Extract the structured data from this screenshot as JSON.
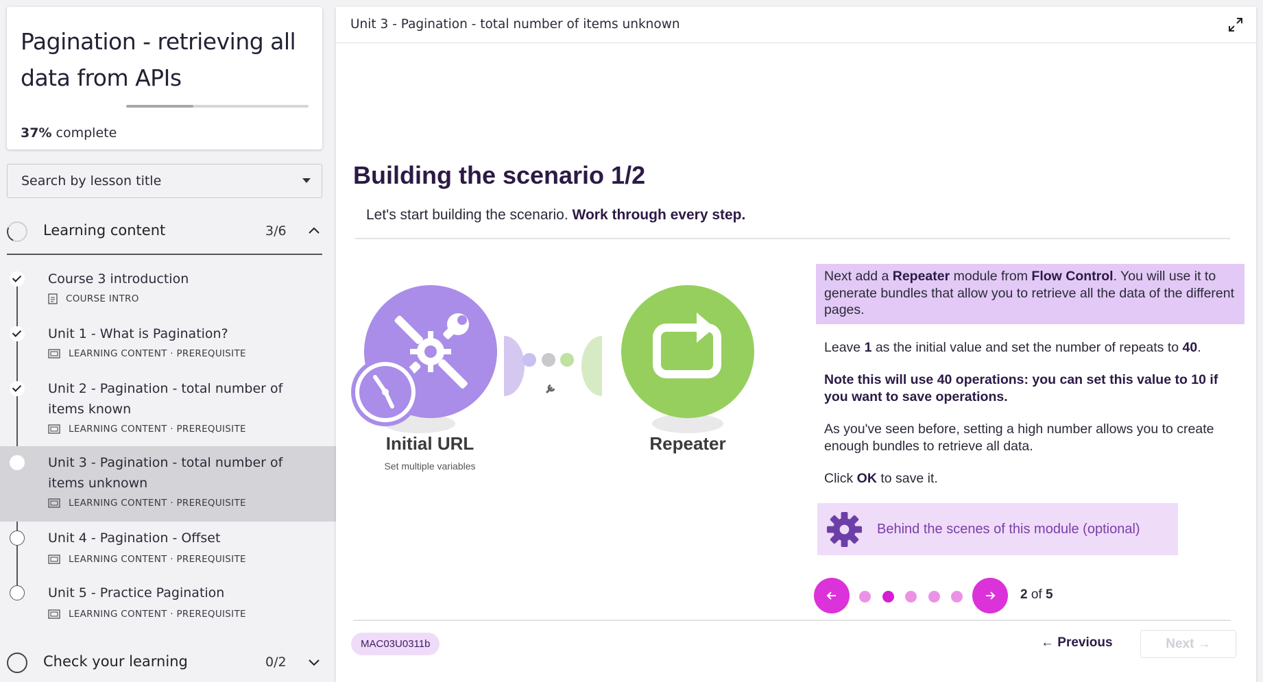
{
  "course": {
    "title": "Pagination - retrieving all data from APIs",
    "progress_percent": "37%",
    "progress_suffix": " complete",
    "progress_fraction": 0.37
  },
  "search": {
    "placeholder": "Search by lesson title"
  },
  "sections": [
    {
      "label": "Learning content",
      "count": "3/6",
      "expanded": true
    },
    {
      "label": "Check your learning",
      "count": "0/2",
      "expanded": false
    }
  ],
  "lessons": [
    {
      "title": "Course 3 introduction",
      "meta": "COURSE INTRO",
      "status": "done"
    },
    {
      "title": "Unit 1 - What is Pagination?",
      "meta": "LEARNING CONTENT · PREREQUISITE",
      "status": "done"
    },
    {
      "title": "Unit 2 - Pagination - total number of items known",
      "meta": "LEARNING CONTENT · PREREQUISITE",
      "status": "done"
    },
    {
      "title": "Unit 3 - Pagination - total number of items unknown",
      "meta": "LEARNING CONTENT · PREREQUISITE",
      "status": "current"
    },
    {
      "title": "Unit 4 - Pagination - Offset",
      "meta": "LEARNING CONTENT · PREREQUISITE",
      "status": "todo"
    },
    {
      "title": "Unit 5 - Practice Pagination",
      "meta": "LEARNING CONTENT · PREREQUISITE",
      "status": "todo"
    }
  ],
  "topbar": {
    "unit_title": "Unit 3 - Pagination - total number of items unknown"
  },
  "lesson": {
    "heading": "Building the scenario 1/2",
    "intro_plain": "Let's start building the scenario. ",
    "intro_bold": "Work through every step."
  },
  "diagram": {
    "module1_label": "Initial URL",
    "module1_sub": "Set multiple variables",
    "module2_label": "Repeater",
    "colors": {
      "tools": "#a98de8",
      "repeater": "#97cf5e"
    }
  },
  "instructions": {
    "highlight": {
      "p1": "Next add a ",
      "b1": "Repeater",
      "p2": " module from ",
      "b2": "Flow Control",
      "p3": ". You will use it to generate bundles that allow you to retrieve all the data of the different pages."
    },
    "leave": {
      "p1": "Leave ",
      "b1": "1",
      "p2": " as the initial value and set the number of repeats to ",
      "b2": "40",
      "p3": "."
    },
    "note": "Note this will use 40 operations: you can set this value to 10 if you want to save operations.",
    "seen": "As you've seen before, setting a high number allows you to create enough bundles to retrieve all data.",
    "click": {
      "p1": "Click ",
      "b1": "OK",
      "p2": " to save it."
    },
    "accordion_label": "Behind the scenes of this module (optional)"
  },
  "pager": {
    "current": "2",
    "separator": " of ",
    "total": "5",
    "dots": 5,
    "active_index": 1
  },
  "footer": {
    "code": "MAC03U0311b",
    "previous": "← Previous",
    "next": "Next →"
  },
  "colors": {
    "accent": "#dc32d9",
    "highlight_bg": "#e3c9f6",
    "heading": "#2c1a45"
  }
}
